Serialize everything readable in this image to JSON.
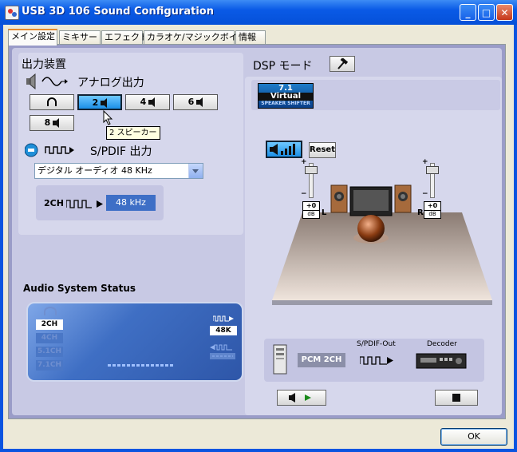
{
  "window": {
    "title": "USB 3D 106 Sound Configuration"
  },
  "tabs": [
    "メイン設定",
    "ミキサー",
    "エフェクト",
    "カラオケ/マジックボイス",
    "情報"
  ],
  "output": {
    "section_title": "出力装置",
    "analog_label": "アナログ出力",
    "buttons": [
      "2",
      "4",
      "6",
      "8"
    ],
    "tooltip": "2 スピーカー",
    "spdif_label": "S/PDIF 出力",
    "spdif_select": "デジタル オーディオ 48 KHz",
    "spdif_ch": "2CH",
    "spdif_rate": "48 kHz"
  },
  "status": {
    "title": "Audio System Status",
    "channels": [
      "2CH",
      "4CH",
      "5.1CH",
      "7.1CH"
    ],
    "rate": "48K"
  },
  "dsp": {
    "title": "DSP モード",
    "badge_top": "7.1",
    "badge_mid": "Virtual",
    "badge_bottom": "SPEAKER SHIFTER",
    "reset_label": "Reset",
    "left_gain": "+0",
    "right_gain": "+0",
    "gain_unit": "dB",
    "left_ch": "L",
    "right_ch": "R",
    "plus": "+",
    "minus": "−",
    "pcm_label": "PCM 2CH",
    "spdif_out": "S/PDIF-Out",
    "decoder": "Decoder"
  },
  "ok_label": "OK",
  "colors": {
    "titlebar": "#0a54e0",
    "panel": "#c8c9e4",
    "accent": "#1b8fe6"
  }
}
